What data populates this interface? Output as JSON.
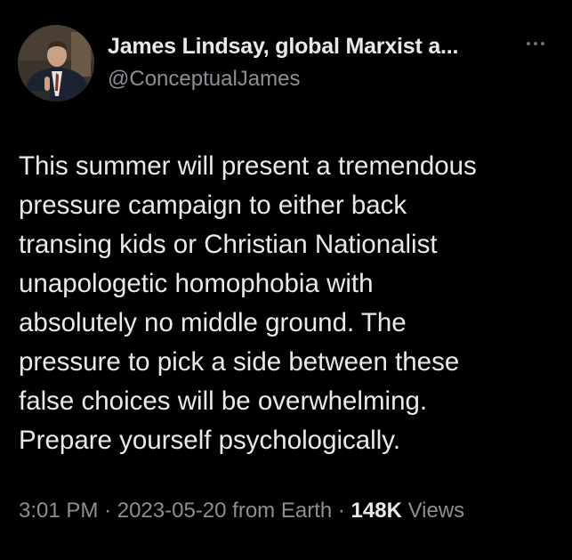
{
  "author": {
    "display_name": "James Lindsay, global Marxist a...",
    "handle": "@ConceptualJames"
  },
  "tweet": {
    "lines": [
      "This summer will present a tremendous",
      "pressure campaign to either back",
      "transing kids or Christian Nationalist",
      "unapologetic homophobia with",
      "absolutely no middle ground. The",
      "pressure to pick a side between these",
      "false choices will be overwhelming.",
      "Prepare yourself psychologically."
    ]
  },
  "meta": {
    "time": "3:01 PM",
    "separator": "·",
    "date": "2023-05-20",
    "source": "from Earth",
    "views_count": "148K",
    "views_label": "Views"
  },
  "icons": {
    "more": "more-horizontal-icon"
  },
  "colors": {
    "background": "#000000",
    "primary_text": "#e7e9ea",
    "secondary_text": "#8b8f94"
  }
}
